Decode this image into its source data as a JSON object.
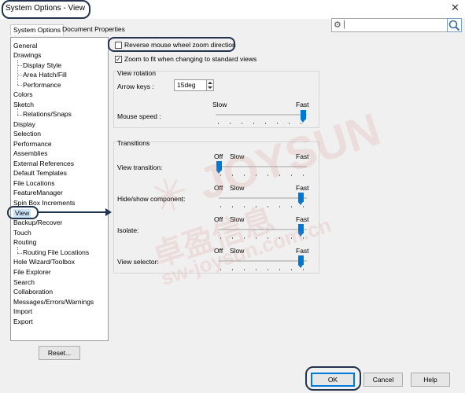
{
  "window": {
    "title": "System Options - View",
    "close_glyph": "✕"
  },
  "tabs": [
    {
      "label": "System Options",
      "active": true
    },
    {
      "label": "Document Properties",
      "active": false
    }
  ],
  "search": {
    "value": "",
    "icon": "magnifier-icon",
    "gear_icon": "gear-icon"
  },
  "tree": {
    "items": [
      {
        "label": "General"
      },
      {
        "label": "Drawings"
      },
      {
        "label": "Display Style"
      },
      {
        "label": "Area Hatch/Fill"
      },
      {
        "label": "Performance"
      },
      {
        "label": "Colors"
      },
      {
        "label": "Sketch"
      },
      {
        "label": "Relations/Snaps"
      },
      {
        "label": "Display"
      },
      {
        "label": "Selection"
      },
      {
        "label": "Performance"
      },
      {
        "label": "Assemblies"
      },
      {
        "label": "External References"
      },
      {
        "label": "Default Templates"
      },
      {
        "label": "File Locations"
      },
      {
        "label": "FeatureManager"
      },
      {
        "label": "Spin Box Increments"
      },
      {
        "label": "View",
        "selected": true
      },
      {
        "label": "Backup/Recover"
      },
      {
        "label": "Touch"
      },
      {
        "label": "Routing"
      },
      {
        "label": "Routing File Locations"
      },
      {
        "label": "Hole Wizard/Toolbox"
      },
      {
        "label": "File Explorer"
      },
      {
        "label": "Search"
      },
      {
        "label": "Collaboration"
      },
      {
        "label": "Messages/Errors/Warnings"
      },
      {
        "label": "Import"
      },
      {
        "label": "Export"
      }
    ]
  },
  "reset_label": "Reset...",
  "options": {
    "reverse_wheel": {
      "label": "Reverse mouse wheel zoom direction",
      "checked": false
    },
    "zoom_to_fit": {
      "label": "Zoom to fit when changing to standard views",
      "checked": true
    }
  },
  "view_rotation": {
    "title": "View rotation",
    "arrow_keys_label": "Arrow keys :",
    "arrow_keys_value": "15deg",
    "mouse_speed_label": "Mouse speed :",
    "slow_label": "Slow",
    "fast_label": "Fast",
    "mouse_speed_level": 1.0
  },
  "transitions": {
    "title": "Transitions",
    "off_label": "Off",
    "slow_label": "Slow",
    "fast_label": "Fast",
    "rows": [
      {
        "label": "View transition:",
        "level": 0.0
      },
      {
        "label": "Hide/show component:",
        "level": 1.0
      },
      {
        "label": "Isolate:",
        "level": 1.0
      },
      {
        "label": "View selector:",
        "level": 1.0
      }
    ]
  },
  "footer": {
    "ok": "OK",
    "cancel": "Cancel",
    "help": "Help"
  },
  "colors": {
    "accent": "#0078d7",
    "annotation": "#23344f"
  }
}
